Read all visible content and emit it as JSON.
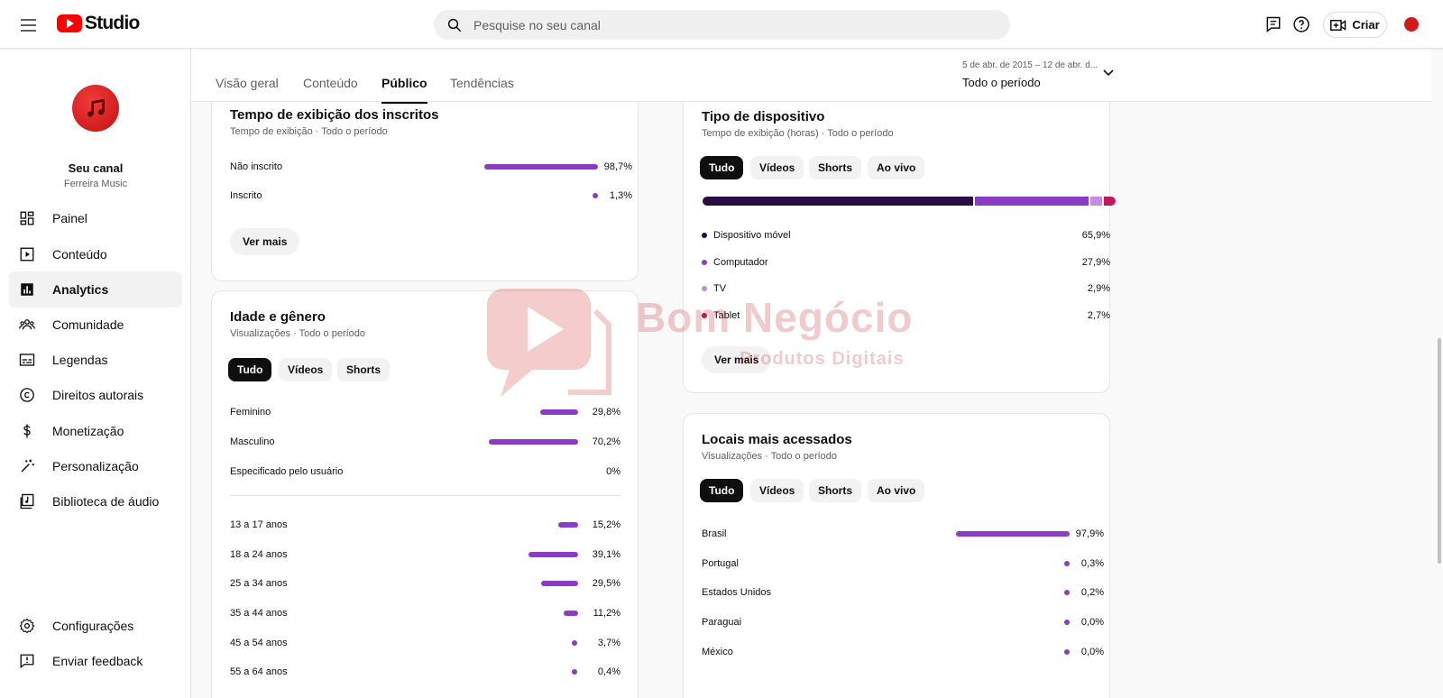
{
  "topbar": {
    "logo_text": "Studio",
    "search_placeholder": "Pesquise no seu canal",
    "create_label": "Criar"
  },
  "sidebar": {
    "channel_title": "Seu canal",
    "channel_name": "Ferreira Music",
    "items": [
      {
        "label": "Painel",
        "icon": "dashboard-icon"
      },
      {
        "label": "Conteúdo",
        "icon": "content-icon"
      },
      {
        "label": "Analytics",
        "icon": "analytics-icon",
        "active": true
      },
      {
        "label": "Comunidade",
        "icon": "community-icon"
      },
      {
        "label": "Legendas",
        "icon": "subtitles-icon"
      },
      {
        "label": "Direitos autorais",
        "icon": "copyright-icon"
      },
      {
        "label": "Monetização",
        "icon": "dollar-icon"
      },
      {
        "label": "Personalização",
        "icon": "magic-wand-icon"
      },
      {
        "label": "Biblioteca de áudio",
        "icon": "audio-library-icon"
      }
    ],
    "bottom_items": [
      {
        "label": "Configurações",
        "icon": "gear-icon"
      },
      {
        "label": "Enviar feedback",
        "icon": "feedback-icon"
      }
    ]
  },
  "tabs": [
    {
      "label": "Visão geral"
    },
    {
      "label": "Conteúdo"
    },
    {
      "label": "Público",
      "active": true
    },
    {
      "label": "Tendências"
    }
  ],
  "period": {
    "range": "5 de abr. de 2015 – 12 de abr. d...",
    "label": "Todo o período"
  },
  "subscribers_watch": {
    "title": "Tempo de exibição dos inscritos",
    "subtitle": "Tempo de exibição · Todo o período",
    "rows": [
      {
        "label": "Não inscrito",
        "value": "98,7%",
        "pct": 98.7
      },
      {
        "label": "Inscrito",
        "value": "1,3%",
        "pct": 1.3
      }
    ],
    "button": "Ver mais"
  },
  "age_gender": {
    "title": "Idade e gênero",
    "subtitle": "Visualizações · Todo o período",
    "chips": [
      "Tudo",
      "Vídeos",
      "Shorts"
    ],
    "selected_chip": "Tudo",
    "gender_rows": [
      {
        "label": "Feminino",
        "value": "29,8%",
        "pct": 29.8
      },
      {
        "label": "Masculino",
        "value": "70,2%",
        "pct": 70.2
      },
      {
        "label": "Especificado pelo usuário",
        "value": "0%",
        "pct": 0
      }
    ],
    "age_rows": [
      {
        "label": "13 a 17 anos",
        "value": "15,2%",
        "pct": 15.2
      },
      {
        "label": "18 a 24 anos",
        "value": "39,1%",
        "pct": 39.1
      },
      {
        "label": "25 a 34 anos",
        "value": "29,5%",
        "pct": 29.5
      },
      {
        "label": "35 a 44 anos",
        "value": "11,2%",
        "pct": 11.2
      },
      {
        "label": "45 a 54 anos",
        "value": "3,7%",
        "pct": 3.7
      },
      {
        "label": "55 a 64 anos",
        "value": "0,4%",
        "pct": 0.4
      }
    ]
  },
  "device_type": {
    "title": "Tipo de dispositivo",
    "subtitle": "Tempo de exibição (horas) · Todo o período",
    "chips": [
      "Tudo",
      "Vídeos",
      "Shorts",
      "Ao vivo"
    ],
    "selected_chip": "Tudo",
    "rows": [
      {
        "label": "Dispositivo móvel",
        "value": "65,9%",
        "pct": 65.9,
        "color": "#2a0d45"
      },
      {
        "label": "Computador",
        "value": "27,9%",
        "pct": 27.9,
        "color": "#8b3cc7"
      },
      {
        "label": "TV",
        "value": "2,9%",
        "pct": 2.9,
        "color": "#c78ae6"
      },
      {
        "label": "Tablet",
        "value": "2,7%",
        "pct": 2.7,
        "color": "#c2185b"
      }
    ],
    "button": "Ver mais"
  },
  "top_locations": {
    "title": "Locais mais acessados",
    "subtitle": "Visualizações · Todo o período",
    "chips": [
      "Tudo",
      "Vídeos",
      "Shorts",
      "Ao vivo"
    ],
    "selected_chip": "Tudo",
    "rows": [
      {
        "label": "Brasil",
        "value": "97,9%",
        "pct": 97.9
      },
      {
        "label": "Portugal",
        "value": "0,3%",
        "pct": 0.3
      },
      {
        "label": "Estados Unidos",
        "value": "0,2%",
        "pct": 0.2
      },
      {
        "label": "Paraguai",
        "value": "0,0%",
        "pct": 0.0
      },
      {
        "label": "México",
        "value": "0,0%",
        "pct": 0.0
      }
    ]
  },
  "watermark": {
    "brand": "Bom Negócio",
    "tagline": "Produtos Digitais"
  },
  "colors": {
    "accent": "#8b3cc7",
    "brand_red": "#ff0000"
  }
}
